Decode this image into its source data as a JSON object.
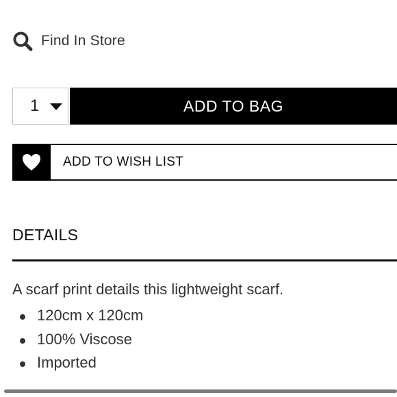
{
  "find_in_store": {
    "icon": "search-icon",
    "label": "Find In Store"
  },
  "purchase": {
    "quantity": "1",
    "add_to_bag_label": "ADD TO BAG"
  },
  "wish_list": {
    "icon": "heart-icon",
    "label": "ADD TO WISH LIST"
  },
  "details": {
    "heading": "DETAILS",
    "description": "A scarf print details this lightweight scarf.",
    "bullets": [
      "120cm x 120cm",
      "100% Viscose",
      "Imported"
    ]
  },
  "colors": {
    "primary": "#000000",
    "text": "#333333",
    "border": "#bdbdbd"
  }
}
